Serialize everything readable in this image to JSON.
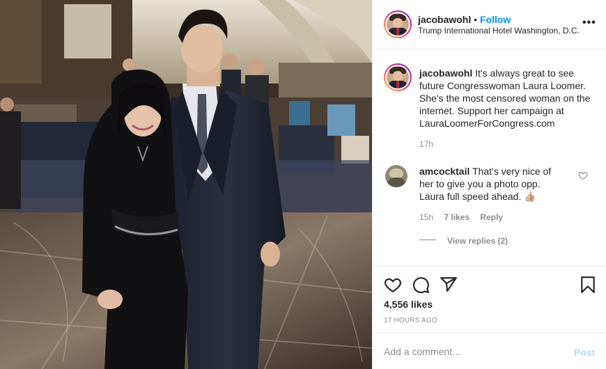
{
  "post": {
    "photo_alt": "",
    "header": {
      "username": "jacobawohl",
      "separator": "•",
      "follow_label": "Follow",
      "location": "Trump International Hotel Washington, D.C.",
      "more_label": "•••"
    },
    "caption": {
      "username": "jacobawohl",
      "text": "It's always great to see future Congresswoman Laura Loomer. She's the most censored woman on the internet. Support her campaign at LauraLoomerForCongress.com",
      "time": "17h"
    },
    "comments": [
      {
        "username": "amcocktail",
        "text": "That's very nice of her to give you a photo opp. Laura full speed ahead. 👍🏼",
        "time": "15h",
        "likes": "7 likes",
        "reply_label": "Reply",
        "view_replies": "View replies (2)"
      }
    ],
    "actions": {
      "likes": "4,556 likes",
      "timestamp": "17 HOURS AGO"
    },
    "add_comment": {
      "placeholder": "Add a comment…",
      "post_label": "Post"
    }
  },
  "colors": {
    "accent": "#0095f6",
    "post_disabled": "#b3dbff",
    "secondary_text": "#8e8e8e",
    "border": "#efefef"
  },
  "icons": [
    "more-options-icon",
    "heart-icon",
    "comment-icon",
    "share-icon",
    "save-bookmark-icon",
    "comment-like-heart-icon"
  ]
}
